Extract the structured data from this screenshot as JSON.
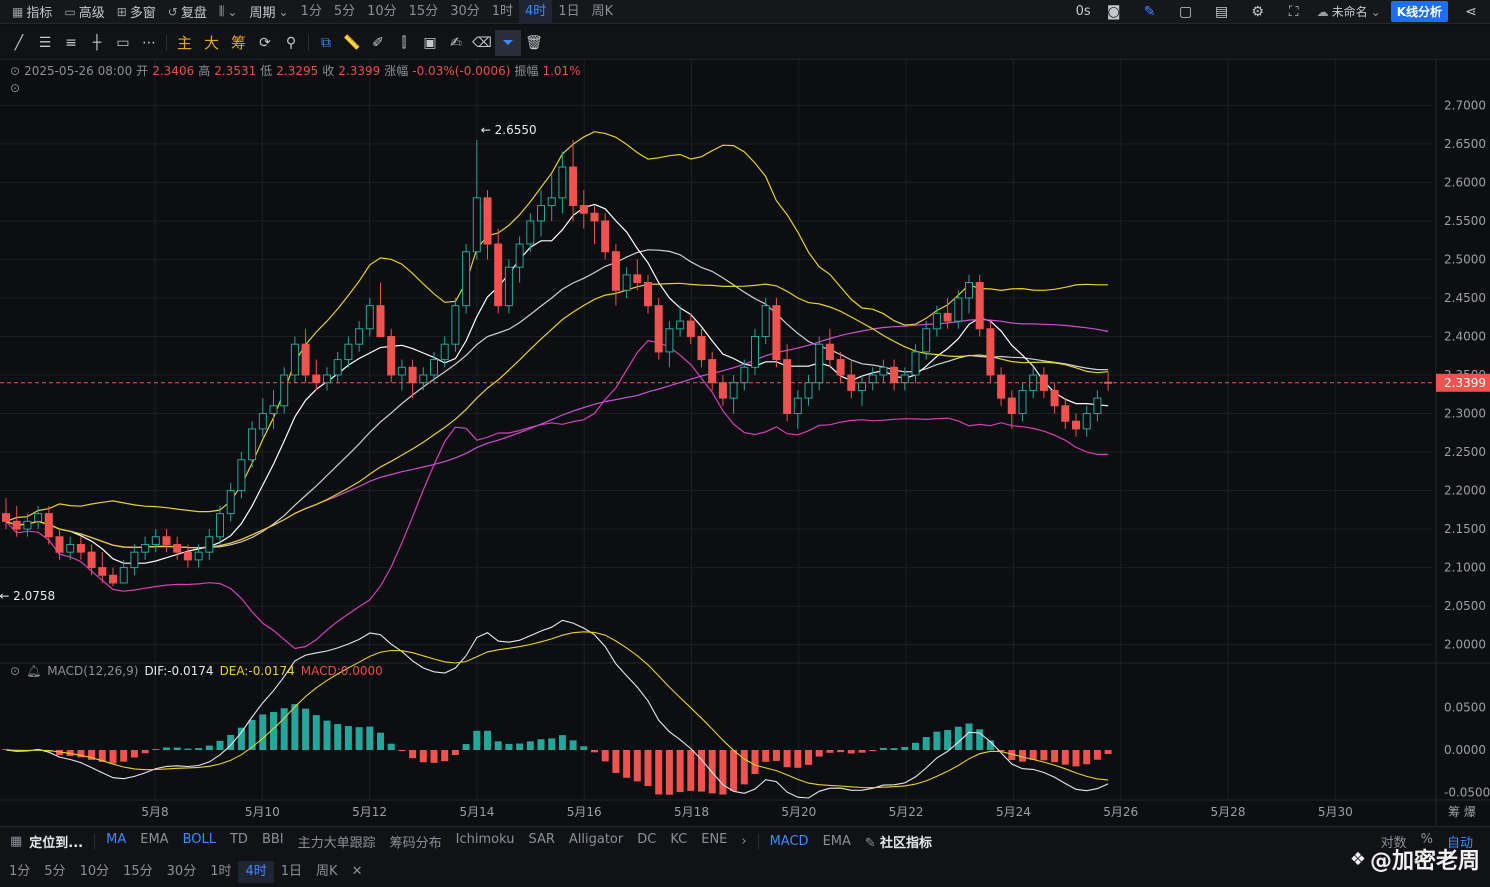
{
  "topbar": {
    "items": [
      {
        "icon": "chart-line-icon",
        "label": "指标"
      },
      {
        "icon": "calendar-icon",
        "label": "高级"
      },
      {
        "icon": "grid-icon",
        "label": "多窗"
      },
      {
        "icon": "replay-icon",
        "label": "复盘"
      },
      {
        "icon": "candle-type-icon",
        "label": ""
      },
      {
        "icon": "",
        "label": "周期"
      }
    ],
    "periods": [
      "1分",
      "5分",
      "10分",
      "15分",
      "30分",
      "1时",
      "4时",
      "1日",
      "周K"
    ],
    "active_period": "4时",
    "right": {
      "latency": "0s",
      "layout_name": "未命名",
      "kline_button": "K线分析"
    }
  },
  "toolbar": {
    "text_tools": [
      "主",
      "大",
      "筹"
    ]
  },
  "info": {
    "date": "2025-05-26 08:00",
    "open_label": "开",
    "open": "2.3406",
    "high_label": "高",
    "high": "2.3531",
    "low_label": "低",
    "low": "2.3295",
    "close_label": "收",
    "close": "2.3399",
    "change_label": "涨幅",
    "change": "-0.03%(-0.0006)",
    "amp_label": "振幅",
    "amp": "1.01%"
  },
  "macd_info": {
    "name": "MACD(12,26,9)",
    "dif": "DIF:-0.0174",
    "dea": "DEA:-0.0174",
    "macd": "MACD:0.0000"
  },
  "indicators": {
    "locate": "定位到...",
    "main": [
      "MA",
      "EMA",
      "BOLL",
      "TD",
      "BBI",
      "主力大单跟踪",
      "筹码分布",
      "Ichimoku",
      "SAR",
      "Alligator",
      "DC",
      "KC",
      "ENE"
    ],
    "main_active": [
      "MA",
      "BOLL"
    ],
    "sub": [
      "MACD",
      "EMA"
    ],
    "sub_active": [
      "MACD"
    ],
    "community": "社区指标",
    "right": [
      "对数",
      "%",
      "自动"
    ]
  },
  "timebar": {
    "periods": [
      "1分",
      "5分",
      "10分",
      "15分",
      "30分",
      "1时",
      "4时",
      "1日",
      "周K"
    ],
    "active": "4时"
  },
  "watermark": "@加密老周",
  "colors": {
    "up": "#26a69a",
    "down": "#ef5350",
    "boll_upper": "#e6d227",
    "boll_lower": "#d63fb7",
    "ma_white": "#d0d0d0",
    "price_line": "#ef5350",
    "accent": "#3d8bfd"
  },
  "chart_data": {
    "type": "candlestick",
    "price_axis": {
      "min": 1.98,
      "max": 2.72,
      "ticks": [
        "2.7000",
        "2.6500",
        "2.6000",
        "2.5500",
        "2.5000",
        "2.4500",
        "2.4000",
        "2.3500",
        "2.3000",
        "2.2500",
        "2.2000",
        "2.1500",
        "2.1000",
        "2.0500",
        "2.0000"
      ]
    },
    "x_labels": [
      "5月8",
      "5月10",
      "5月12",
      "5月14",
      "5月16",
      "5月18",
      "5月20",
      "5月22",
      "5月24",
      "5月26",
      "5月28",
      "5月30"
    ],
    "last_price": "2.3399",
    "annotations": [
      {
        "text": "← 2.6550",
        "price": 2.655
      },
      {
        "text": "← 2.0758",
        "price": 2.0758
      }
    ],
    "candles": [
      [
        2.17,
        2.19,
        2.15,
        2.16
      ],
      [
        2.16,
        2.18,
        2.14,
        2.15
      ],
      [
        2.15,
        2.17,
        2.14,
        2.16
      ],
      [
        2.16,
        2.18,
        2.15,
        2.17
      ],
      [
        2.17,
        2.18,
        2.13,
        2.14
      ],
      [
        2.14,
        2.15,
        2.11,
        2.12
      ],
      [
        2.12,
        2.14,
        2.11,
        2.13
      ],
      [
        2.13,
        2.14,
        2.11,
        2.12
      ],
      [
        2.12,
        2.13,
        2.09,
        2.1
      ],
      [
        2.1,
        2.12,
        2.08,
        2.09
      ],
      [
        2.09,
        2.1,
        2.076,
        2.08
      ],
      [
        2.08,
        2.11,
        2.08,
        2.1
      ],
      [
        2.1,
        2.13,
        2.09,
        2.12
      ],
      [
        2.12,
        2.14,
        2.11,
        2.13
      ],
      [
        2.13,
        2.15,
        2.12,
        2.14
      ],
      [
        2.14,
        2.15,
        2.12,
        2.13
      ],
      [
        2.13,
        2.14,
        2.11,
        2.12
      ],
      [
        2.12,
        2.13,
        2.1,
        2.11
      ],
      [
        2.11,
        2.13,
        2.1,
        2.12
      ],
      [
        2.12,
        2.15,
        2.11,
        2.14
      ],
      [
        2.14,
        2.18,
        2.13,
        2.17
      ],
      [
        2.17,
        2.21,
        2.16,
        2.2
      ],
      [
        2.2,
        2.25,
        2.19,
        2.24
      ],
      [
        2.24,
        2.29,
        2.23,
        2.28
      ],
      [
        2.28,
        2.32,
        2.27,
        2.3
      ],
      [
        2.3,
        2.33,
        2.28,
        2.31
      ],
      [
        2.31,
        2.36,
        2.3,
        2.35
      ],
      [
        2.35,
        2.4,
        2.34,
        2.39
      ],
      [
        2.39,
        2.41,
        2.34,
        2.35
      ],
      [
        2.35,
        2.37,
        2.33,
        2.34
      ],
      [
        2.34,
        2.36,
        2.33,
        2.35
      ],
      [
        2.35,
        2.38,
        2.34,
        2.37
      ],
      [
        2.37,
        2.4,
        2.36,
        2.39
      ],
      [
        2.39,
        2.42,
        2.38,
        2.41
      ],
      [
        2.41,
        2.45,
        2.4,
        2.44
      ],
      [
        2.44,
        2.47,
        2.42,
        2.4
      ],
      [
        2.4,
        2.41,
        2.34,
        2.35
      ],
      [
        2.35,
        2.37,
        2.33,
        2.36
      ],
      [
        2.36,
        2.37,
        2.32,
        2.34
      ],
      [
        2.34,
        2.36,
        2.33,
        2.35
      ],
      [
        2.35,
        2.38,
        2.34,
        2.37
      ],
      [
        2.37,
        2.4,
        2.36,
        2.39
      ],
      [
        2.39,
        2.45,
        2.38,
        2.44
      ],
      [
        2.44,
        2.52,
        2.43,
        2.51
      ],
      [
        2.51,
        2.655,
        2.5,
        2.58
      ],
      [
        2.58,
        2.59,
        2.5,
        2.52
      ],
      [
        2.52,
        2.54,
        2.43,
        2.44
      ],
      [
        2.44,
        2.5,
        2.43,
        2.49
      ],
      [
        2.49,
        2.53,
        2.47,
        2.52
      ],
      [
        2.52,
        2.56,
        2.51,
        2.55
      ],
      [
        2.55,
        2.59,
        2.53,
        2.57
      ],
      [
        2.57,
        2.61,
        2.55,
        2.58
      ],
      [
        2.58,
        2.64,
        2.56,
        2.62
      ],
      [
        2.62,
        2.655,
        2.55,
        2.57
      ],
      [
        2.57,
        2.59,
        2.54,
        2.56
      ],
      [
        2.56,
        2.57,
        2.52,
        2.55
      ],
      [
        2.55,
        2.56,
        2.5,
        2.51
      ],
      [
        2.51,
        2.52,
        2.44,
        2.46
      ],
      [
        2.46,
        2.49,
        2.45,
        2.48
      ],
      [
        2.48,
        2.5,
        2.46,
        2.47
      ],
      [
        2.47,
        2.48,
        2.43,
        2.44
      ],
      [
        2.44,
        2.45,
        2.37,
        2.38
      ],
      [
        2.38,
        2.42,
        2.36,
        2.41
      ],
      [
        2.41,
        2.44,
        2.4,
        2.42
      ],
      [
        2.42,
        2.43,
        2.39,
        2.4
      ],
      [
        2.4,
        2.41,
        2.36,
        2.37
      ],
      [
        2.37,
        2.38,
        2.33,
        2.34
      ],
      [
        2.34,
        2.35,
        2.31,
        2.32
      ],
      [
        2.32,
        2.35,
        2.3,
        2.34
      ],
      [
        2.34,
        2.37,
        2.33,
        2.36
      ],
      [
        2.36,
        2.41,
        2.35,
        2.4
      ],
      [
        2.4,
        2.45,
        2.39,
        2.44
      ],
      [
        2.44,
        2.45,
        2.36,
        2.37
      ],
      [
        2.37,
        2.39,
        2.29,
        2.3
      ],
      [
        2.3,
        2.33,
        2.28,
        2.32
      ],
      [
        2.32,
        2.35,
        2.31,
        2.34
      ],
      [
        2.34,
        2.4,
        2.33,
        2.39
      ],
      [
        2.39,
        2.41,
        2.36,
        2.37
      ],
      [
        2.37,
        2.38,
        2.34,
        2.35
      ],
      [
        2.35,
        2.37,
        2.32,
        2.33
      ],
      [
        2.33,
        2.35,
        2.31,
        2.34
      ],
      [
        2.34,
        2.36,
        2.33,
        2.35
      ],
      [
        2.35,
        2.37,
        2.34,
        2.36
      ],
      [
        2.36,
        2.37,
        2.33,
        2.34
      ],
      [
        2.34,
        2.36,
        2.33,
        2.35
      ],
      [
        2.35,
        2.39,
        2.34,
        2.38
      ],
      [
        2.38,
        2.42,
        2.37,
        2.41
      ],
      [
        2.41,
        2.44,
        2.4,
        2.43
      ],
      [
        2.43,
        2.45,
        2.41,
        2.42
      ],
      [
        2.42,
        2.46,
        2.41,
        2.45
      ],
      [
        2.45,
        2.48,
        2.43,
        2.47
      ],
      [
        2.47,
        2.48,
        2.4,
        2.41
      ],
      [
        2.41,
        2.42,
        2.34,
        2.35
      ],
      [
        2.35,
        2.36,
        2.31,
        2.32
      ],
      [
        2.32,
        2.33,
        2.28,
        2.3
      ],
      [
        2.3,
        2.34,
        2.29,
        2.33
      ],
      [
        2.33,
        2.36,
        2.32,
        2.35
      ],
      [
        2.35,
        2.36,
        2.32,
        2.33
      ],
      [
        2.33,
        2.34,
        2.3,
        2.31
      ],
      [
        2.31,
        2.32,
        2.28,
        2.29
      ],
      [
        2.29,
        2.3,
        2.27,
        2.28
      ],
      [
        2.28,
        2.31,
        2.27,
        2.3
      ],
      [
        2.3,
        2.33,
        2.29,
        2.32
      ],
      [
        2.3406,
        2.3531,
        2.3295,
        2.3399
      ]
    ],
    "macd_axis": {
      "ticks": [
        "0.0500",
        "0.0000",
        "-0.0500"
      ]
    }
  }
}
